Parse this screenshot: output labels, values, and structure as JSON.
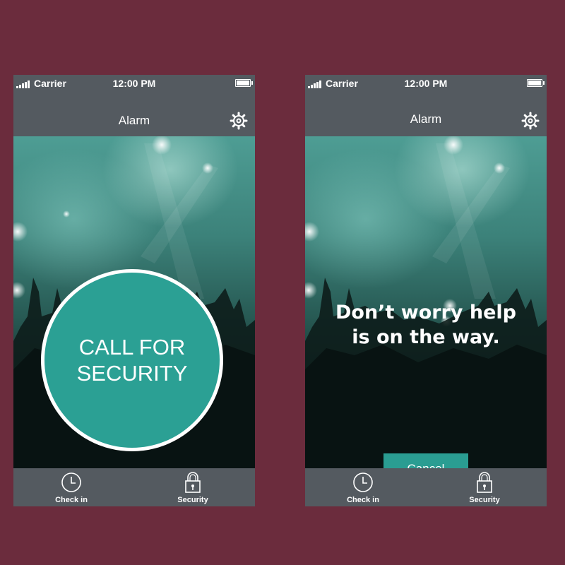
{
  "colors": {
    "background": "#6b2c3d",
    "bar": "#545a60",
    "accent": "#2ba094",
    "white": "#ffffff"
  },
  "screens": [
    {
      "status": {
        "carrier": "Carrier",
        "time": "12:00 PM"
      },
      "nav": {
        "title": "Alarm",
        "settings_icon": "gear-icon"
      },
      "call_button": {
        "line1": "CALL FOR",
        "line2": "SECURITY"
      },
      "tabs": [
        {
          "label": "Check in",
          "icon": "clock-icon"
        },
        {
          "label": "Security",
          "icon": "lock-icon"
        }
      ]
    },
    {
      "status": {
        "carrier": "Carrier",
        "time": "12:00 PM"
      },
      "nav": {
        "title": "Alarm",
        "settings_icon": "gear-icon"
      },
      "message": {
        "line1": "Don’t worry help",
        "line2": "is on the way."
      },
      "cancel_label": "Cancel",
      "tabs": [
        {
          "label": "Check in",
          "icon": "clock-icon"
        },
        {
          "label": "Security",
          "icon": "lock-icon"
        }
      ]
    }
  ]
}
